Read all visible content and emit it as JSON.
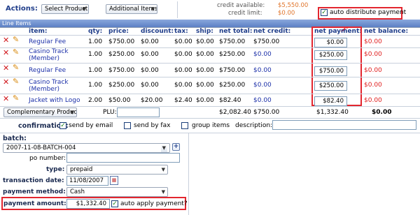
{
  "actions": {
    "label": "Actions:",
    "select_product": "Select Product",
    "additional_items": "Additional Items"
  },
  "credit": {
    "available_label": "credit available:",
    "available_value": "$5,550.00",
    "limit_label": "credit limit:",
    "limit_value": "$0.00"
  },
  "auto_distribute": {
    "label": "auto distribute payment",
    "checked": true
  },
  "line_items": {
    "title": "Line Items",
    "columns": [
      "item:",
      "qty:",
      "price:",
      "discount:",
      "tax:",
      "ship:",
      "net total:",
      "net credit:",
      "net payment:",
      "net balance:"
    ],
    "rows": [
      {
        "item": "Regular Fee",
        "item2": "",
        "qty": "1.00",
        "price": "$750.00",
        "discount": "$0.00",
        "tax": "$0.00",
        "ship": "$0.00",
        "net_total": "$750.00",
        "net_credit": "$750.00",
        "net_payment": "$0.00",
        "net_balance": "$0.00"
      },
      {
        "item": "Casino Track",
        "item2": "(Member)",
        "qty": "1.00",
        "price": "$250.00",
        "discount": "$0.00",
        "tax": "$0.00",
        "ship": "$0.00",
        "net_total": "$250.00",
        "net_credit": "$0.00",
        "net_payment": "$250.00",
        "net_balance": "$0.00"
      },
      {
        "item": "Regular Fee",
        "item2": "",
        "qty": "1.00",
        "price": "$750.00",
        "discount": "$0.00",
        "tax": "$0.00",
        "ship": "$0.00",
        "net_total": "$750.00",
        "net_credit": "$0.00",
        "net_payment": "$750.00",
        "net_balance": "$0.00"
      },
      {
        "item": "Casino Track",
        "item2": "(Member)",
        "qty": "1.00",
        "price": "$250.00",
        "discount": "$0.00",
        "tax": "$0.00",
        "ship": "$0.00",
        "net_total": "$250.00",
        "net_credit": "$0.00",
        "net_payment": "$250.00",
        "net_balance": "$0.00"
      },
      {
        "item": "Jacket with Logo",
        "item2": "",
        "qty": "2.00",
        "price": "$50.00",
        "discount": "$20.00",
        "tax": "$2.40",
        "ship": "$0.00",
        "net_total": "$82.40",
        "net_credit": "$0.00",
        "net_payment": "$82.40",
        "net_balance": "$0.00"
      }
    ],
    "footer": {
      "dropdown": "Complementary Products",
      "plu_label": "PLU:",
      "total": "$2,082.40",
      "credit": "$750.00",
      "payment": "$1,332.40",
      "balance": "$0.00"
    }
  },
  "confirmation": {
    "label": "confirmation:",
    "send_email": "send by email",
    "send_fax": "send by fax",
    "group_items": "group items",
    "description_label": "description:"
  },
  "batch": {
    "label": "batch:",
    "value": "2007-11-08-BATCH-004",
    "po_label": "po number:",
    "type_label": "type:",
    "type_value": "prepaid",
    "date_label": "transaction date:",
    "date_value": "11/08/2007",
    "method_label": "payment method:",
    "method_value": "Cash",
    "amount_label": "payment amount:",
    "amount_value": "$1,332.40",
    "auto_apply": "auto apply payment?"
  },
  "colors": {
    "red_highlight": "#e3262f",
    "header_bar": "#6b8fd0",
    "blue_text": "#1b2fa8",
    "red_text": "#e02020"
  }
}
